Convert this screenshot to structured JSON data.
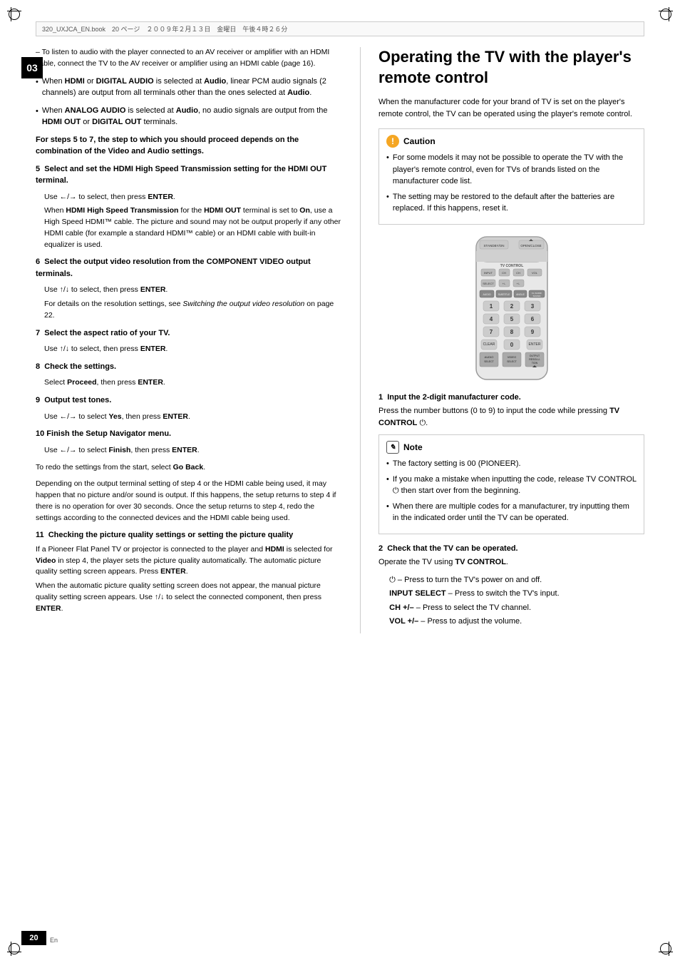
{
  "page": {
    "file_info": "320_UXJCA_EN.book　20 ページ　２００９年２月１３日　金曜日　午後４時２６分",
    "chapter_number": "03",
    "page_number": "20",
    "page_en": "En"
  },
  "left_column": {
    "intro_bullets": [
      "– To listen to audio with the player connected to an AV receiver or amplifier with an HDMI cable, connect the TV to the AV receiver or amplifier using an HDMI cable (page 16).",
      "When HDMI or DIGITAL AUDIO is selected at Audio, linear PCM audio signals (2 channels) are output from all terminals other than the ones selected at Audio.",
      "When ANALOG AUDIO is selected at Audio, no audio signals are output from the HDMI OUT or DIGITAL OUT terminals."
    ],
    "bold_para": "For steps 5 to 7, the step to which you should proceed depends on the combination of the Video and Audio settings.",
    "steps": [
      {
        "num": "5",
        "header": "Select and set the HDMI High Speed Transmission setting for the HDMI OUT terminal.",
        "instruction": "Use ←/→ to select, then press ENTER.",
        "sub_text": "When HDMI High Speed Transmission for the HDMI OUT terminal is set to On, use a High Speed HDMI™ cable. The picture and sound may not be output properly if any other HDMI cable (for example a standard HDMI™ cable) or an HDMI cable with built-in equalizer is used."
      },
      {
        "num": "6",
        "header": "Select the output video resolution from the COMPONENT VIDEO output terminals.",
        "instruction": "Use ↑/↓ to select, then press ENTER.",
        "sub_text": "For details on the resolution settings, see Switching the output video resolution on page 22."
      },
      {
        "num": "7",
        "header": "Select the aspect ratio of your TV.",
        "instruction": "Use ↑/↓ to select, then press ENTER."
      },
      {
        "num": "8",
        "header": "Check the settings.",
        "instruction": "Select Proceed, then press ENTER."
      },
      {
        "num": "9",
        "header": "Output test tones.",
        "instruction": "Use ←/→ to select Yes, then press ENTER."
      },
      {
        "num": "10",
        "header": "Finish the Setup Navigator menu.",
        "instruction": "Use ←/→ to select Finish, then press ENTER."
      }
    ],
    "go_back_text": "To redo the settings from the start, select Go Back.",
    "warning_para": "Depending on the output terminal setting of step 4 or the HDMI cable being used, it may happen that no picture and/or sound is output. If this happens, the setup returns to step 4 if there is no operation for over 30 seconds. Once the setup returns to step 4, redo the settings according to the connected devices and the HDMI cable being used.",
    "step11_header": "11  Checking the picture quality settings or setting the picture quality",
    "step11_body": "If a Pioneer Flat Panel TV or projector is connected to the player and HDMI is selected for Video in step 4, the player sets the picture quality automatically. The automatic picture quality setting screen appears. Press ENTER.",
    "step11_body2": "When the automatic picture quality setting screen does not appear, the manual picture quality setting screen appears. Use ↑/↓ to select the connected component, then press ENTER."
  },
  "right_column": {
    "title": "Operating the TV with the player's remote control",
    "intro": "When the manufacturer code for your brand of TV is set on the player's remote control, the TV can be operated using the player's remote control.",
    "caution": {
      "title": "Caution",
      "items": [
        "For some models it may not be possible to operate the TV with the player's remote control, even for TVs of brands listed on the manufacturer code list.",
        "The setting may be restored to the default after the batteries are replaced. If this happens, reset it."
      ]
    },
    "steps": [
      {
        "num": "1",
        "header": "Input the 2-digit manufacturer code.",
        "body": "Press the number buttons (0 to 9) to input the code while pressing TV CONTROL ⏻."
      },
      {
        "num": "2",
        "header": "Check that the TV can be operated.",
        "body": "Operate the TV using TV CONTROL.",
        "sub_items": [
          "⏻ – Press to turn the TV's power on and off.",
          "INPUT SELECT – Press to switch the TV's input.",
          "CH +/– – Press to select the TV channel.",
          "VOL +/– – Press to adjust the volume."
        ]
      }
    ],
    "note": {
      "title": "Note",
      "items": [
        "The factory setting is 00 (PIONEER).",
        "If you make a mistake when inputting the code, release TV CONTROL ⏻ then start over from the beginning.",
        "When there are multiple codes for a manufacturer, try inputting them in the indicated order until the TV can be operated."
      ]
    }
  }
}
